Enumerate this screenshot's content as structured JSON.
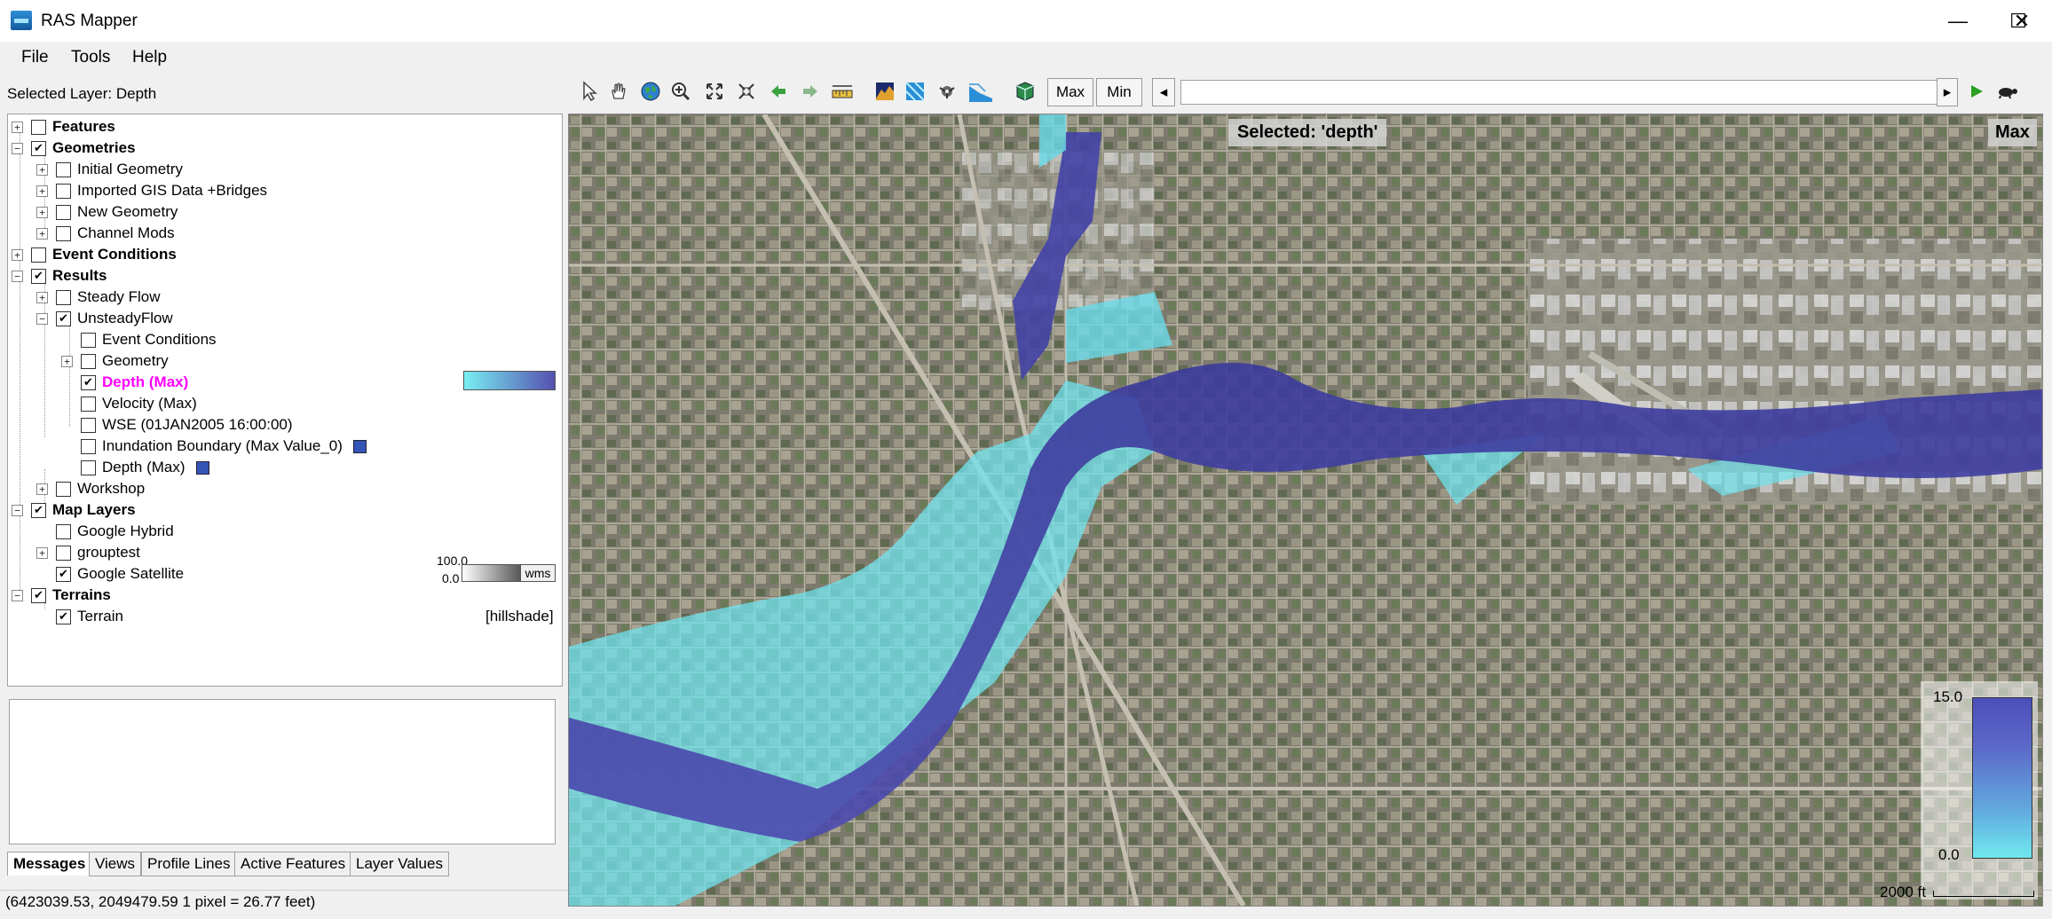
{
  "window": {
    "title": "RAS Mapper",
    "minimize_glyph": "—",
    "maximize_glyph": "☐",
    "close_glyph": "✕"
  },
  "menu": [
    "File",
    "Tools",
    "Help"
  ],
  "selected_layer": "Selected Layer: Depth",
  "tree": {
    "features": "Features",
    "geometries": "Geometries",
    "initial_geometry": "Initial Geometry",
    "imported_gis": "Imported GIS Data +Bridges",
    "new_geometry": "New Geometry",
    "channel_mods": "Channel Mods",
    "event_conditions": "Event Conditions",
    "results": "Results",
    "steady_flow": "Steady Flow",
    "unsteady_flow": "UnsteadyFlow",
    "uf_event_conditions": "Event Conditions",
    "uf_geometry": "Geometry",
    "depth_max": "Depth (Max)",
    "velocity_max": "Velocity (Max)",
    "wse": "WSE (01JAN2005 16:00:00)",
    "inundation_boundary": "Inundation Boundary (Max Value_0)",
    "depth_max_2": "Depth (Max)",
    "workshop": "Workshop",
    "map_layers": "Map Layers",
    "google_hybrid": "Google Hybrid",
    "grouptest": "grouptest",
    "google_satellite": "Google Satellite",
    "sat_min": "0.0",
    "sat_max": "100.0",
    "wms": "wms",
    "terrains": "Terrains",
    "terrain": "Terrain",
    "hillshade": "[hillshade]"
  },
  "tabs": [
    "Messages",
    "Views",
    "Profile Lines",
    "Active Features",
    "Layer Values"
  ],
  "status": "(6423039.53, 2049479.59  1 pixel = 26.77 feet)",
  "toolbar": {
    "max": "Max",
    "min": "Min",
    "prev": "◂",
    "next": "▸"
  },
  "map": {
    "selected_label": "Selected: 'depth'",
    "profile_label": "Max",
    "legend_max": "15.0",
    "legend_min": "0.0",
    "scale": "2000 ft"
  },
  "colors": {
    "depth_deep": "#3d3a9c",
    "depth_shallow": "#6fe9ee",
    "highlight": "#ff00ff"
  }
}
